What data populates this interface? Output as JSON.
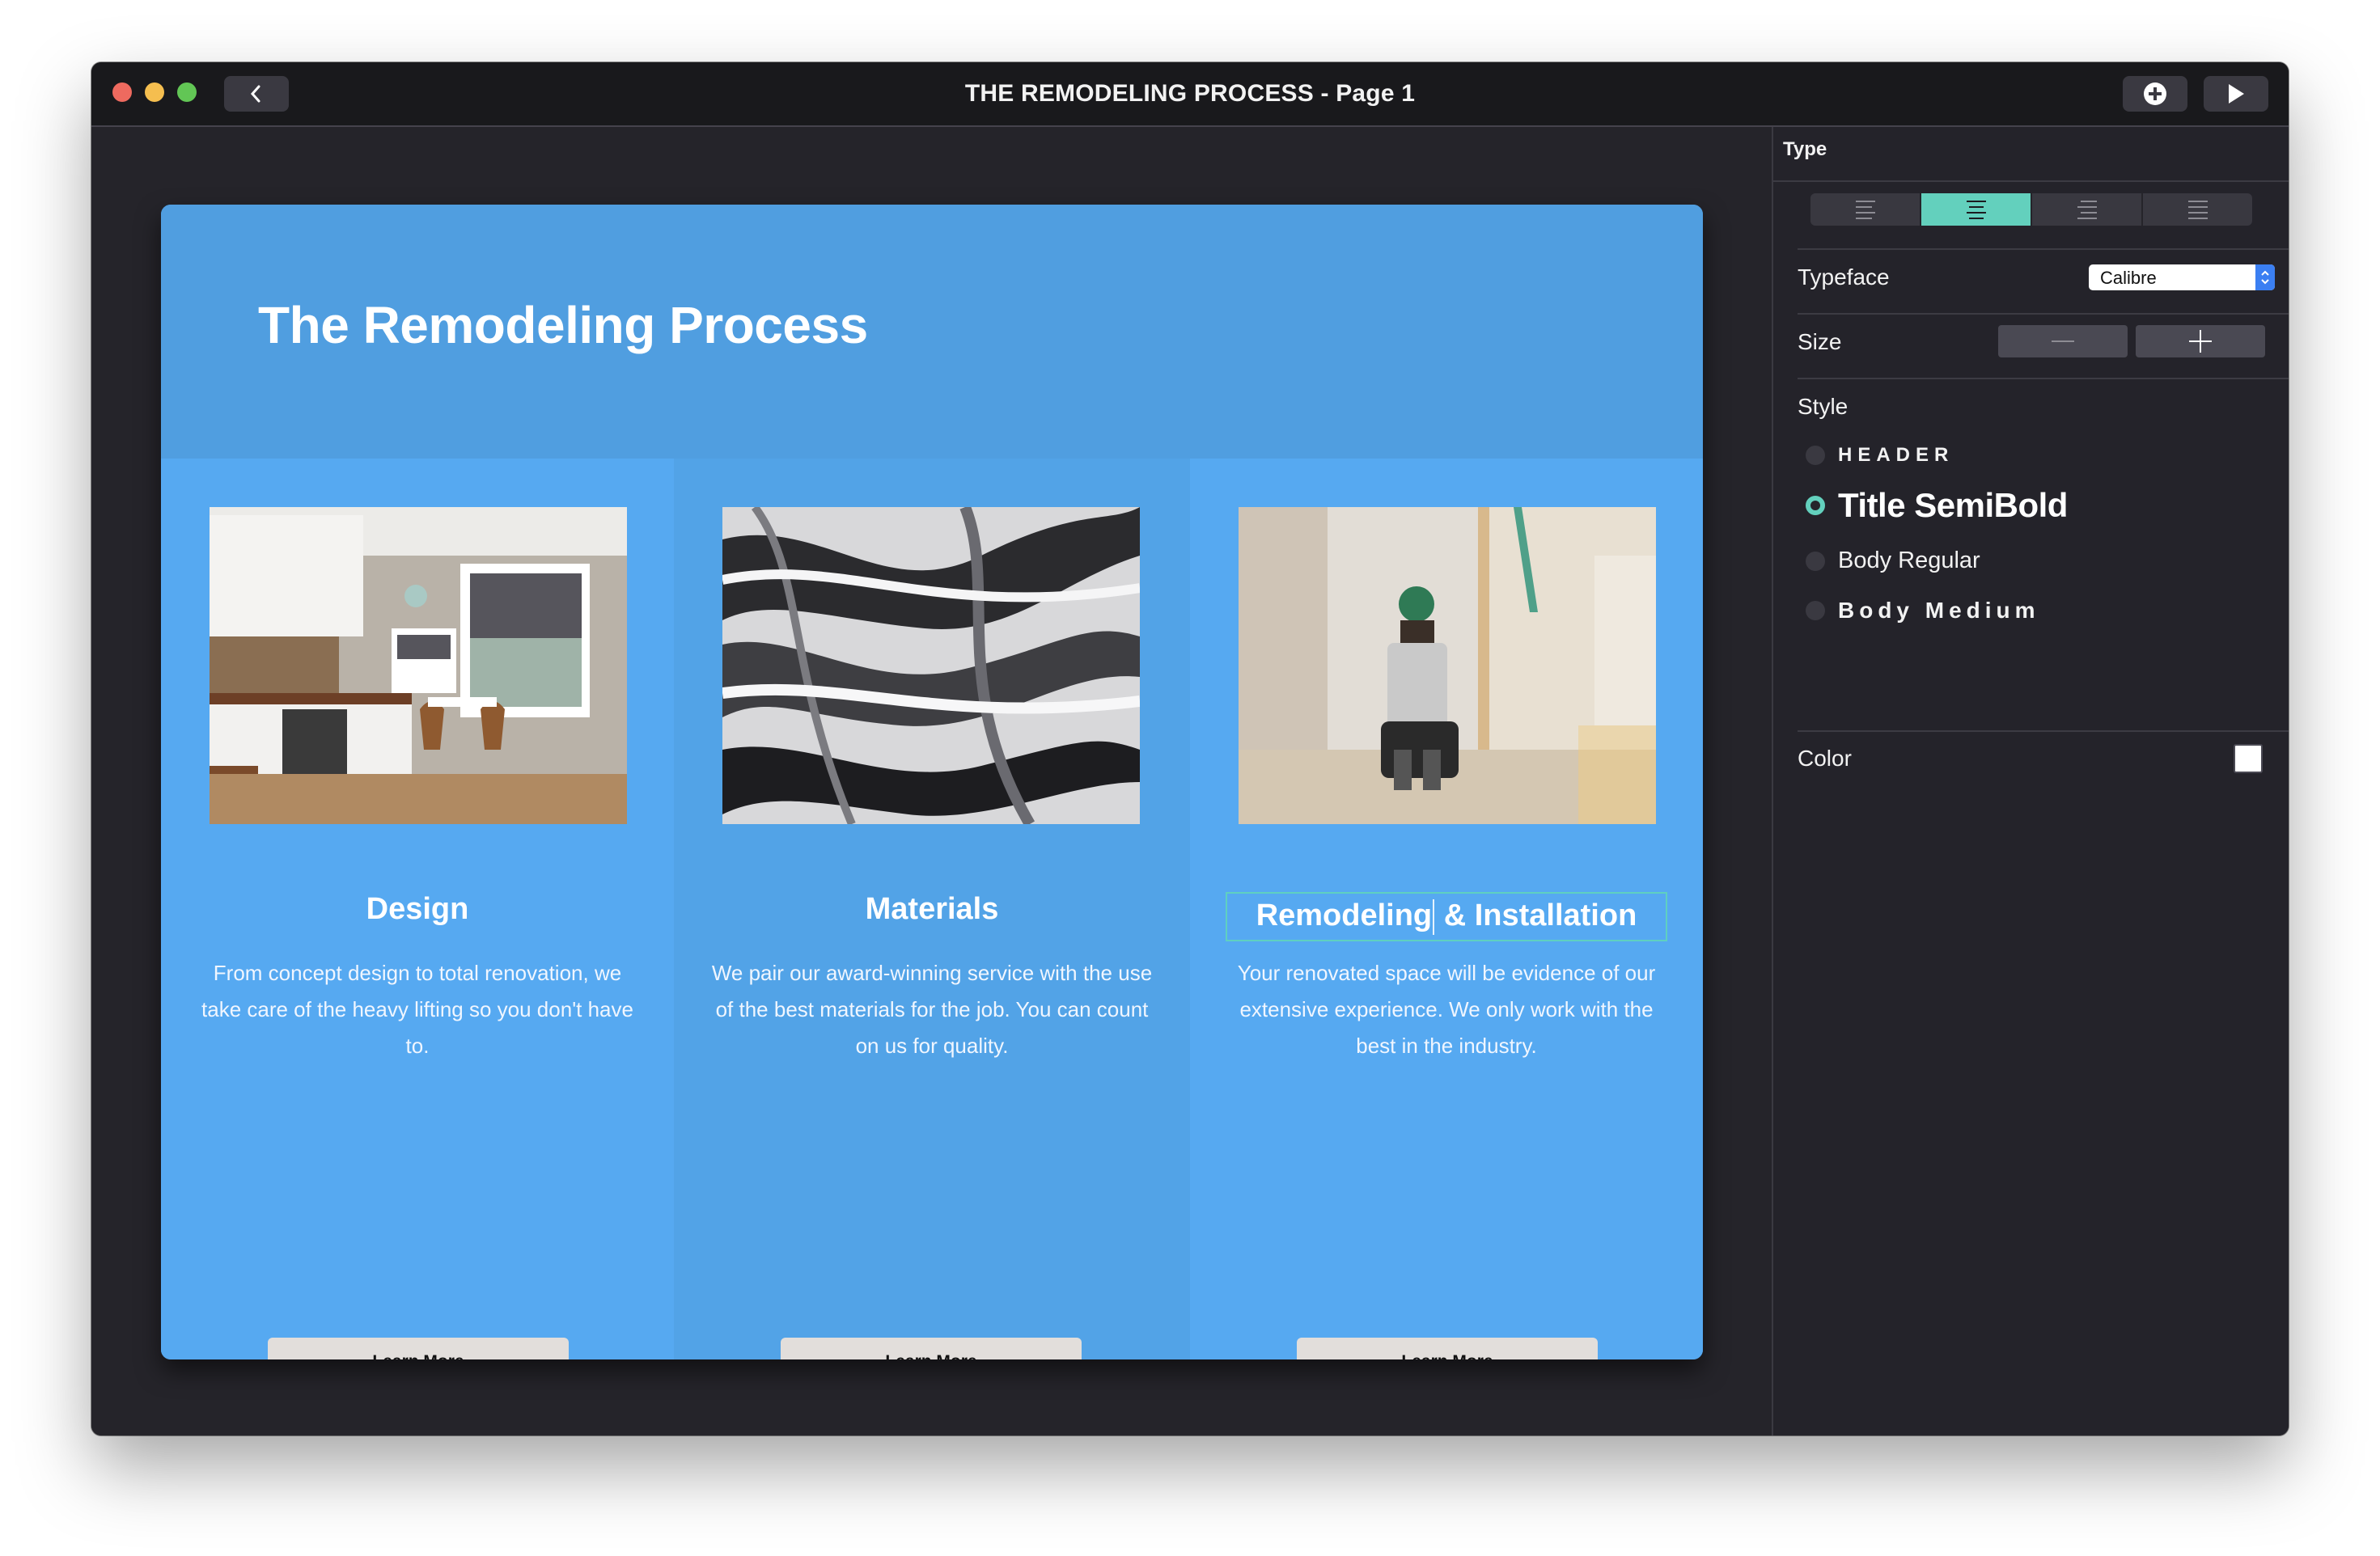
{
  "window": {
    "title": "THE REMODELING PROCESS - Page 1",
    "buttons": {
      "back": "chevron-left-icon",
      "add": "plus-circle-icon",
      "play": "play-icon"
    }
  },
  "canvas": {
    "title": "The Remodeling Process",
    "colors": {
      "header": "#509ee0",
      "body": "#56a9f1",
      "selection": "#5fd0c0"
    },
    "columns": [
      {
        "image": "kitchen-photo",
        "title": "Design",
        "body": "From concept design to total renovation, we take care of the heavy lifting so you don't have to.",
        "button": "Learn More"
      },
      {
        "image": "marble-photo",
        "title": "Materials",
        "body": "We pair our award-winning service with the use of the best materials for the job. You can count on us for quality.",
        "button": "Learn More"
      },
      {
        "image": "construction-worker-photo",
        "title_before_caret": "Remodeling",
        "title_after_caret": " & Installation",
        "body": "Your renovated space will be evidence of our extensive experience. We only work with the best in the industry.",
        "button": "Learn More",
        "selected": true
      }
    ]
  },
  "panel": {
    "section_title": "Type",
    "alignment": {
      "options": [
        "align-left",
        "align-center",
        "align-right",
        "align-justify"
      ],
      "selected": "align-center"
    },
    "typeface": {
      "label": "Typeface",
      "value": "Calibre"
    },
    "size": {
      "label": "Size",
      "decrease": "minus-icon",
      "increase": "plus-icon"
    },
    "style": {
      "label": "Style",
      "options": [
        "HEADER",
        "Title SemiBold",
        "Body Regular",
        "Body Medium"
      ],
      "selected": "Title SemiBold"
    },
    "color": {
      "label": "Color",
      "value": "#ffffff"
    },
    "accent": "#63d0bd"
  }
}
